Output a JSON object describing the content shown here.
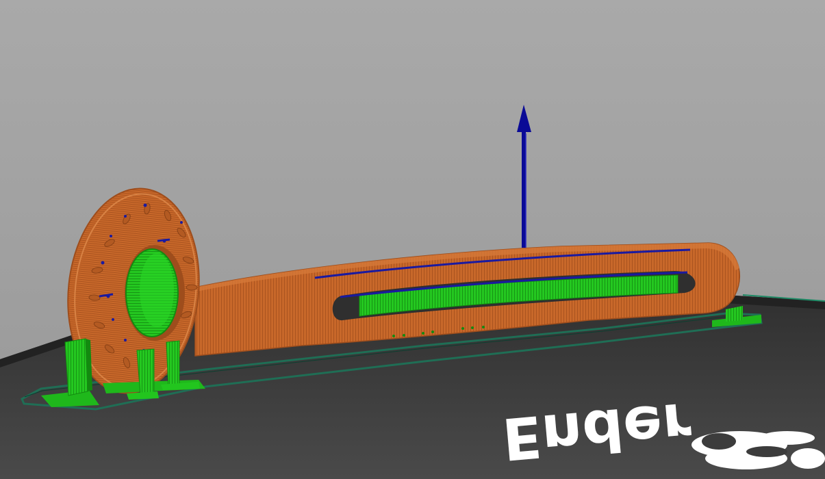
{
  "viewport": {
    "background_top": "#a9a9a9",
    "background_bottom": "#989898"
  },
  "build_plate": {
    "color": "#3c3c3c",
    "edge_color": "#2a2a2a",
    "logo_text": "Ender",
    "logo_color": "#ffffff"
  },
  "model": {
    "wall_color": "#c8682a",
    "wall_dark": "#9e4d1c",
    "support_color": "#22c51e",
    "support_dark": "#138a10",
    "travel_color": "#1a1aa0",
    "skirt_color": "#1f6e55"
  },
  "gizmo": {
    "axis": "z",
    "color": "#0a0a96",
    "icon": "z-axis-arrow-icon"
  }
}
